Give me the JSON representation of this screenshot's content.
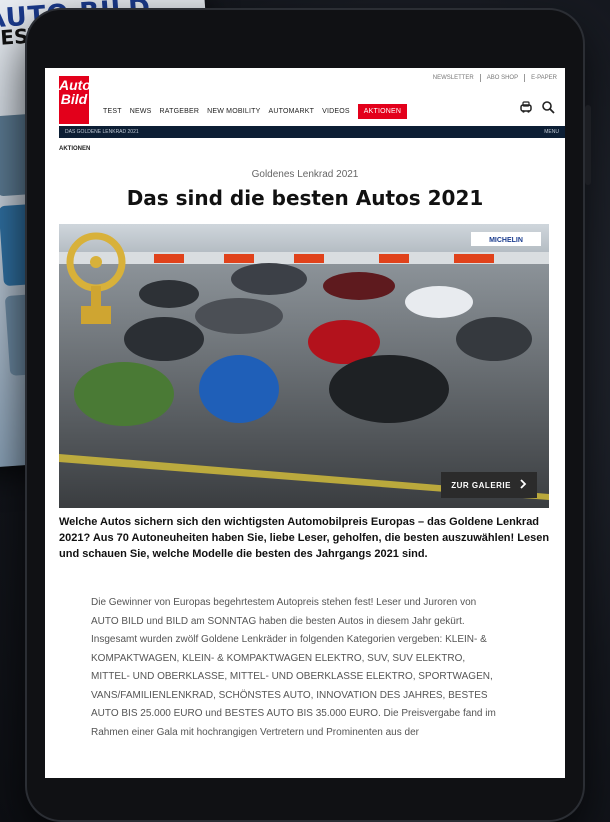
{
  "background": {
    "magazine_title": "AUTO BILD",
    "magazine_subtitle": "TEST ELEKTRO"
  },
  "site": {
    "logo_line1": "Auto",
    "logo_line2": "Bild",
    "brand_color": "#e3001b",
    "top_links": [
      "NEWSLETTER",
      "ABO SHOP",
      "E-PAPER"
    ]
  },
  "nav": {
    "items": [
      "TEST",
      "NEWS",
      "RATGEBER",
      "NEW MOBILITY",
      "AUTOMARKT",
      "VIDEOS"
    ],
    "active": "AKTIONEN"
  },
  "subbar": {
    "left": "DAS GOLDENE LENKRAD 2021",
    "right": "MENU"
  },
  "breadcrumb": "AKTIONEN",
  "article": {
    "kicker": "Goldenes Lenkrad 2021",
    "headline": "Das sind die besten Autos 2021",
    "gallery_button": "ZUR GALERIE",
    "sponsor": "MICHELIN",
    "teaser": "Welche Autos sichern sich den wichtigsten Automobilpreis Europas – das Goldene Lenkrad 2021? Aus 70 Autoneuheiten haben Sie, liebe Leser, geholfen, die besten auszuwählen! Lesen und schauen Sie, welche Modelle die besten des Jahrgangs 2021 sind.",
    "body": "Die Gewinner von Europas begehrtestem Autopreis stehen fest! Leser und Juroren von AUTO BILD und BILD am SONNTAG haben die besten Autos in diesem Jahr gekürt. Insgesamt wurden zwölf Goldene Lenkräder in folgenden Kategorien vergeben: KLEIN- & KOMPAKTWAGEN, KLEIN- & KOMPAKTWAGEN ELEKTRO, SUV, SUV ELEKTRO, MITTEL- UND OBERKLASSE, MITTEL- UND OBERKLASSE ELEKTRO, SPORTWAGEN, VANS/FAMILIENLENKRAD, SCHÖNSTES AUTO, INNOVATION DES JAHRES, BESTES AUTO BIS 25.000 EURO und BESTES AUTO BIS 35.000 EURO. Die Preisvergabe fand im Rahmen einer Gala mit hochrangigen Vertretern und Prominenten aus der"
  },
  "icons": [
    "car-icon",
    "search-icon",
    "chevron-right-icon",
    "trophy-icon"
  ],
  "colors": {
    "nav_dark": "#0c1e34",
    "gallery_button": "#2b2b2b"
  }
}
